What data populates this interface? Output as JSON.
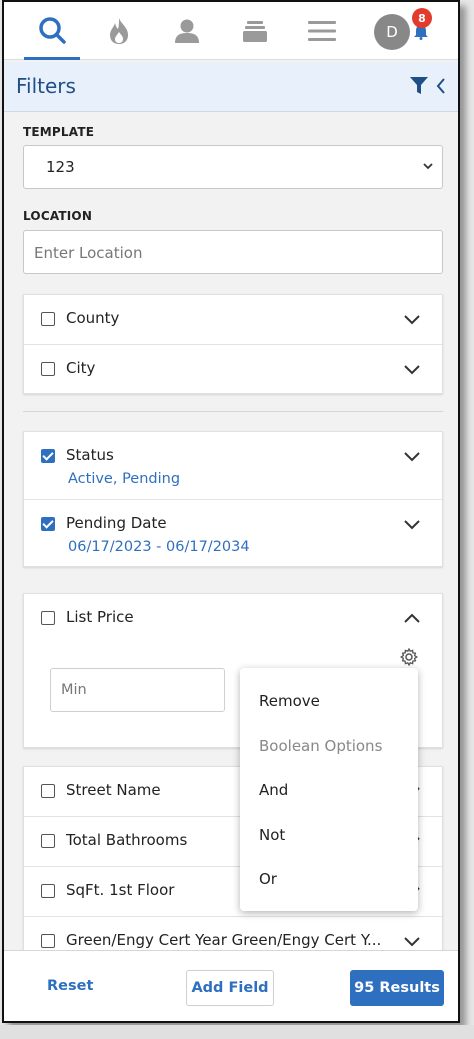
{
  "nav": {
    "items": [
      {
        "icon": "search-icon",
        "active": true
      },
      {
        "icon": "fire-icon",
        "active": false
      },
      {
        "icon": "person-icon",
        "active": false
      },
      {
        "icon": "stack-icon",
        "active": false
      },
      {
        "icon": "menu-icon",
        "active": false
      }
    ],
    "avatar_initial": "D",
    "notification_count": "8"
  },
  "header": {
    "title": "Filters"
  },
  "template": {
    "label": "TEMPLATE",
    "value": "123"
  },
  "location": {
    "label": "LOCATION",
    "placeholder": "Enter Location"
  },
  "location_filters": [
    {
      "label": "County",
      "checked": false
    },
    {
      "label": "City",
      "checked": false
    }
  ],
  "active_filters": [
    {
      "label": "Status",
      "checked": true,
      "value": "Active, Pending"
    },
    {
      "label": "Pending Date",
      "checked": true,
      "value": "06/17/2023 - 06/17/2034"
    }
  ],
  "list_price": {
    "label": "List Price",
    "checked": false,
    "min_placeholder": "Min"
  },
  "options_menu": {
    "items": [
      {
        "label": "Remove",
        "muted": false
      },
      {
        "label": "Boolean Options",
        "muted": true
      },
      {
        "label": "And",
        "muted": false
      },
      {
        "label": "Not",
        "muted": false
      },
      {
        "label": "Or",
        "muted": false
      }
    ]
  },
  "more_filters": [
    {
      "label": "Street Name",
      "checked": false
    },
    {
      "label": "Total Bathrooms",
      "checked": false
    },
    {
      "label": "SqFt. 1st Floor",
      "checked": false
    },
    {
      "label": "Green/Engy Cert Year Green/Engy Cert Y...",
      "checked": false
    }
  ],
  "footer": {
    "reset_label": "Reset",
    "add_field_label": "Add Field",
    "results_label": "95 Results"
  },
  "colors": {
    "accent": "#2f6fc0",
    "header_bg": "#e8f1fb",
    "badge": "#e23b2e"
  }
}
